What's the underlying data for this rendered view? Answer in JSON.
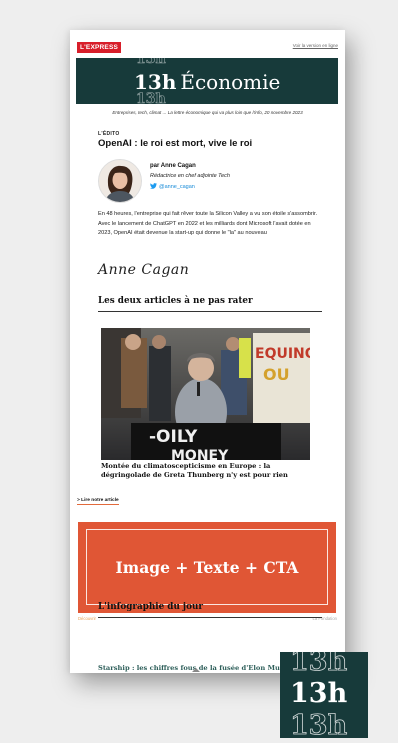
{
  "header": {
    "brand": "L'EXPRESS",
    "view_online": "Voir la version en ligne"
  },
  "banner": {
    "logo": "13h",
    "title": "Économie",
    "ghost": "13h"
  },
  "tagline": "Entreprises, tech, climat ... La lettre économique qui va plus loin que l'info, 20 novembre 2023",
  "edito": {
    "label": "L'ÉDITO",
    "title": "OpenAI : le roi est mort, vive le roi",
    "author_name": "par Anne Cagan",
    "author_role": "Rédactrice en chef adjointe Tech",
    "twitter_handle": "@anne_cagan",
    "twitter_icon": "twitter-bird-icon",
    "body": "En 48 heures, l'entreprise qui fait rêver toute la Silicon Valley a vu son étoile s'assombrir. Avec le lancement de ChatGPT en 2022 et les milliards dont Microsoft l'avait dotée en 2023, OpenAI était devenue la start-up qui donne le \"la\" au nouveau",
    "signature": "Anne Cagan"
  },
  "articles_section": {
    "title": "Les deux articles à ne pas rater",
    "photo_sign_left": "-OILY",
    "photo_sign_left_2": "MONEY",
    "photo_sign_right": "EQUINO",
    "photo_sign_right_2": "OU",
    "article_title": "Montée du climatoscepticisme en Europe : la dégringolade de Greta Thunberg n'y est pour rien",
    "read_link": "> Lire notre article"
  },
  "cta": {
    "label": "Image + Texte + CTA",
    "small_left": "Découvrir",
    "small_right": "La Fondation"
  },
  "infographic": {
    "section_title": "L'infographie du jour",
    "title": "Starship : les chiffres fous de la fusée d'Elon Musk"
  },
  "badge": {
    "text": "13h"
  },
  "colors": {
    "banner_bg": "#173a3a",
    "brand_red": "#d81e2a",
    "cta_orange": "#e05635",
    "link_blue": "#1a8cd8"
  }
}
